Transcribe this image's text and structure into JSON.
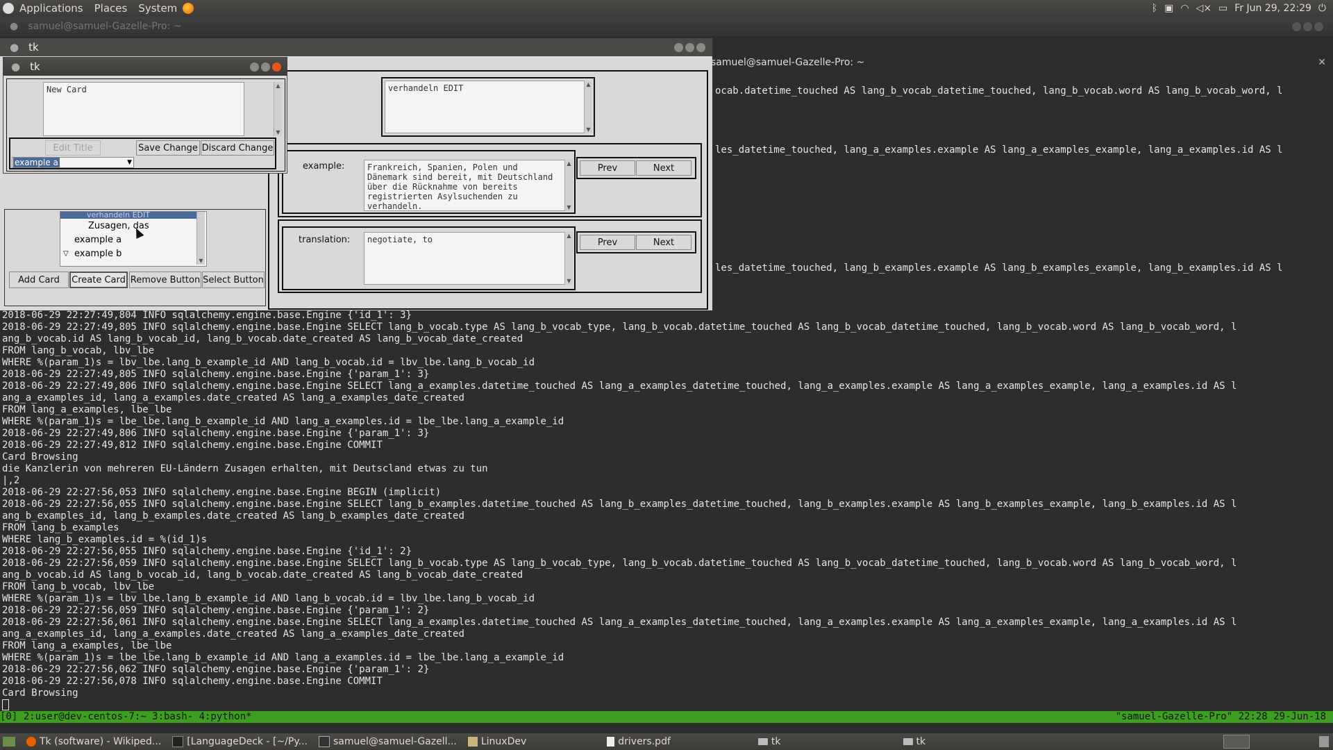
{
  "top_panel": {
    "menus": [
      "Applications",
      "Places",
      "System"
    ],
    "clock": "Fr Jun 29, 22:29"
  },
  "terminal": {
    "window_title": "samuel@samuel-Gazelle-Pro: ~",
    "tab_title": "samuel@samuel-Gazelle-Pro: ~",
    "right_lines": [
      "ocab.datetime_touched AS lang_b_vocab_datetime_touched, lang_b_vocab.word AS lang_b_vocab_word, l",
      "les_datetime_touched, lang_a_examples.example AS lang_a_examples_example, lang_a_examples.id AS l",
      "les_datetime_touched, lang_b_examples.example AS lang_b_examples_example, lang_b_examples.id AS l"
    ],
    "lines": [
      "2018-06-29 22:27:49,804 INFO sqlalchemy.engine.base.Engine {'id_1': 3}",
      "2018-06-29 22:27:49,805 INFO sqlalchemy.engine.base.Engine SELECT lang_b_vocab.type AS lang_b_vocab_type, lang_b_vocab.datetime_touched AS lang_b_vocab_datetime_touched, lang_b_vocab.word AS lang_b_vocab_word, l",
      "ang_b_vocab.id AS lang_b_vocab_id, lang_b_vocab.date_created AS lang_b_vocab_date_created",
      "FROM lang_b_vocab, lbv_lbe",
      "WHERE %(param_1)s = lbv_lbe.lang_b_example_id AND lang_b_vocab.id = lbv_lbe.lang_b_vocab_id",
      "2018-06-29 22:27:49,805 INFO sqlalchemy.engine.base.Engine {'param_1': 3}",
      "2018-06-29 22:27:49,806 INFO sqlalchemy.engine.base.Engine SELECT lang_a_examples.datetime_touched AS lang_a_examples_datetime_touched, lang_a_examples.example AS lang_a_examples_example, lang_a_examples.id AS l",
      "ang_a_examples_id, lang_a_examples.date_created AS lang_a_examples_date_created",
      "FROM lang_a_examples, lbe_lbe",
      "WHERE %(param_1)s = lbe_lbe.lang_b_example_id AND lang_a_examples.id = lbe_lbe.lang_a_example_id",
      "2018-06-29 22:27:49,806 INFO sqlalchemy.engine.base.Engine {'param_1': 3}",
      "2018-06-29 22:27:49,812 INFO sqlalchemy.engine.base.Engine COMMIT",
      "Card Browsing",
      "die Kanzlerin von mehreren EU-Ländern Zusagen erhalten, mit Deutscland etwas zu tun",
      "|,2",
      "2018-06-29 22:27:56,053 INFO sqlalchemy.engine.base.Engine BEGIN (implicit)",
      "2018-06-29 22:27:56,055 INFO sqlalchemy.engine.base.Engine SELECT lang_b_examples.datetime_touched AS lang_b_examples_datetime_touched, lang_b_examples.example AS lang_b_examples_example, lang_b_examples.id AS l",
      "ang_b_examples_id, lang_b_examples.date_created AS lang_b_examples_date_created",
      "FROM lang_b_examples",
      "WHERE lang_b_examples.id = %(id_1)s",
      "2018-06-29 22:27:56,055 INFO sqlalchemy.engine.base.Engine {'id_1': 2}",
      "2018-06-29 22:27:56,059 INFO sqlalchemy.engine.base.Engine SELECT lang_b_vocab.type AS lang_b_vocab_type, lang_b_vocab.datetime_touched AS lang_b_vocab_datetime_touched, lang_b_vocab.word AS lang_b_vocab_word, l",
      "ang_b_vocab.id AS lang_b_vocab_id, lang_b_vocab.date_created AS lang_b_vocab_date_created",
      "FROM lang_b_vocab, lbv_lbe",
      "WHERE %(param_1)s = lbv_lbe.lang_b_example_id AND lang_b_vocab.id = lbv_lbe.lang_b_vocab_id",
      "2018-06-29 22:27:56,059 INFO sqlalchemy.engine.base.Engine {'param_1': 2}",
      "2018-06-29 22:27:56,061 INFO sqlalchemy.engine.base.Engine SELECT lang_a_examples.datetime_touched AS lang_a_examples_datetime_touched, lang_a_examples.example AS lang_a_examples_example, lang_a_examples.id AS l",
      "ang_a_examples_id, lang_a_examples.date_created AS lang_a_examples_date_created",
      "FROM lang_a_examples, lbe_lbe",
      "WHERE %(param_1)s = lbe_lbe.lang_b_example_id AND lang_a_examples.id = lbe_lbe.lang_a_example_id",
      "2018-06-29 22:27:56,062 INFO sqlalchemy.engine.base.Engine {'param_1': 2}",
      "2018-06-29 22:27:56,078 INFO sqlalchemy.engine.base.Engine COMMIT",
      "Card Browsing",
      ""
    ]
  },
  "tmux": {
    "left": "[0] 2:user@dev-centos-7:~  3:bash- 4:python*",
    "right": "\"samuel-Gazelle-Pro\" 22:28 29-Jun-18"
  },
  "taskbar": {
    "items": [
      "Tk (software) - Wikiped...",
      "[LanguageDeck - [~/Py...",
      "samuel@samuel-Gazell...",
      "LinuxDev",
      "drivers.pdf",
      "tk",
      "tk"
    ]
  },
  "tk_main": {
    "title": "tk",
    "vocab_text": "verhandeln EDIT",
    "example_label": "example:",
    "example_text": "Frankreich, Spanien, Polen und Dänemark sind bereit, mit Deutschland über die Rücknahme von bereits registrierten Asylsuchenden zu verhandeln.",
    "translation_label": "translation:",
    "translation_text": "negotiate, to",
    "prev_label": "Prev",
    "next_label": "Next",
    "tree_items": [
      "verhandeln EDIT",
      "Zusagen, das",
      "example a",
      "example b"
    ],
    "add_card": "Add Card",
    "create_card": "Create Card",
    "remove_button": "Remove Button",
    "select_button": "Select Button"
  },
  "tk_popup": {
    "title": "tk",
    "card_text": "New Card",
    "edit_title": "Edit Title",
    "save_change": "Save Change",
    "discard_change": "Discard Change",
    "combo_value": "example a"
  },
  "colors": {
    "terminal_bg": "#2d2d2d",
    "tmux_green": "#3e9e21",
    "close_orange": "#e95420",
    "tk_gray": "#d9d9d9"
  }
}
